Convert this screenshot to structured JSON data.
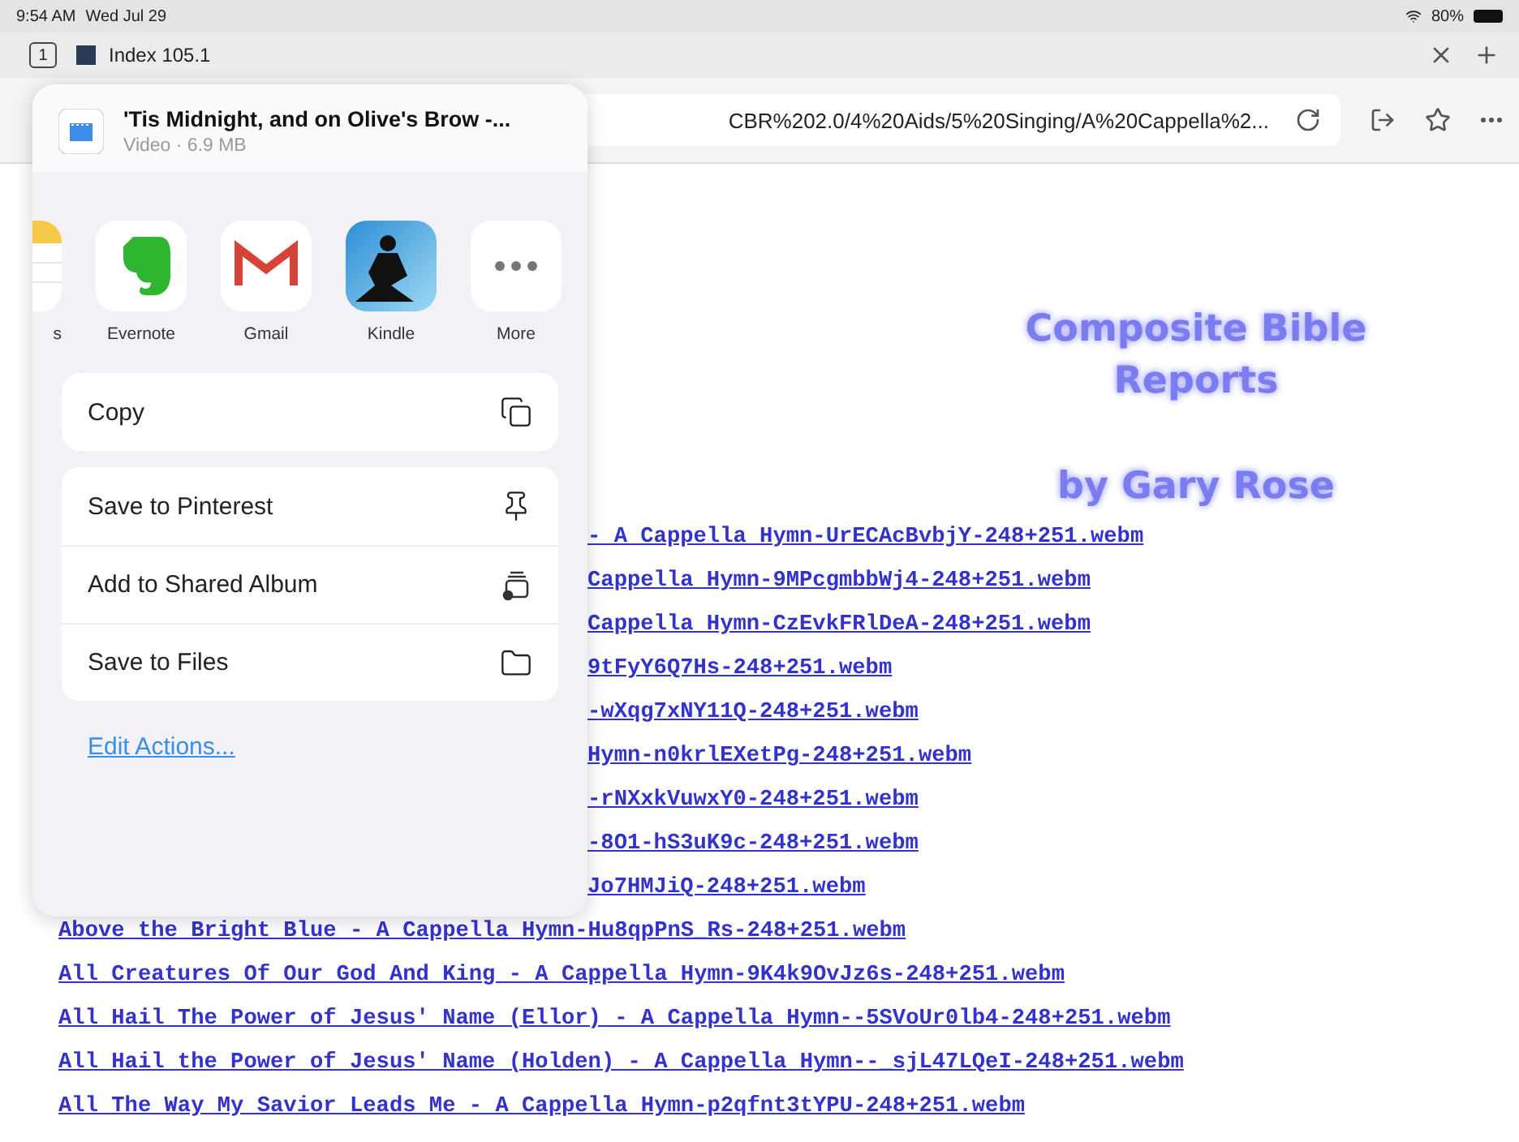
{
  "status_bar": {
    "time": "9:54 AM",
    "date": "Wed Jul 29",
    "battery": "80%"
  },
  "tab_bar": {
    "tab_count": "1",
    "tabs": [
      {
        "title": "Index 105.1",
        "selected": true
      }
    ]
  },
  "address_bar": {
    "url": "CBR%202.0/4%20Aids/5%20Singing/A%20Cappella%2..."
  },
  "page": {
    "heading": [
      "Composite Bible",
      "Reports"
    ],
    "byline": "by Gary Rose",
    "covered_links": [
      "- A Cappella Hymn-UrECAcBvbjY-248+251.webm",
      "Cappella Hymn-9MPcgmbbWj4-248+251.webm",
      "Cappella Hymn-CzEvkFRlDeA-248+251.webm",
      "9tFyY6Q7Hs-248+251.webm",
      "-wXqg7xNY11Q-248+251.webm",
      "Hymn-n0krlEXetPg-248+251.webm",
      "-rNXxkVuwxY0-248+251.webm",
      "-8O1-hS3uK9c-248+251.webm",
      "Jo7HMJiQ-248+251.webm"
    ],
    "links": [
      "Above the Bright Blue - A Cappella Hymn-Hu8qpPnS_Rs-248+251.webm",
      "All Creatures Of Our God And King - A Cappella Hymn-9K4k9OvJz6s-248+251.webm",
      "All Hail The Power of Jesus' Name (Ellor) - A Cappella Hymn--5SVoUr0lb4-248+251.webm",
      "All Hail the Power of Jesus' Name (Holden) - A Cappella Hymn--_sjL47LQeI-248+251.webm",
      "All The Way My Savior Leads Me - A Cappella Hymn-p2qfnt3tYPU-248+251.webm"
    ]
  },
  "share_sheet": {
    "file": {
      "title": "'Tis Midnight, and on Olive's Brow -...",
      "subtitle": "Video · 6.9 MB"
    },
    "apps": [
      {
        "kind": "notes",
        "label": "s"
      },
      {
        "kind": "evernote",
        "label": "Evernote"
      },
      {
        "kind": "gmail",
        "label": "Gmail"
      },
      {
        "kind": "kindle",
        "label": "Kindle"
      },
      {
        "kind": "more",
        "label": "More"
      }
    ],
    "action_groups": [
      [
        "Copy"
      ],
      [
        "Save to Pinterest",
        "Add to Shared Album",
        "Save to Files"
      ]
    ],
    "edit_actions": "Edit Actions..."
  }
}
